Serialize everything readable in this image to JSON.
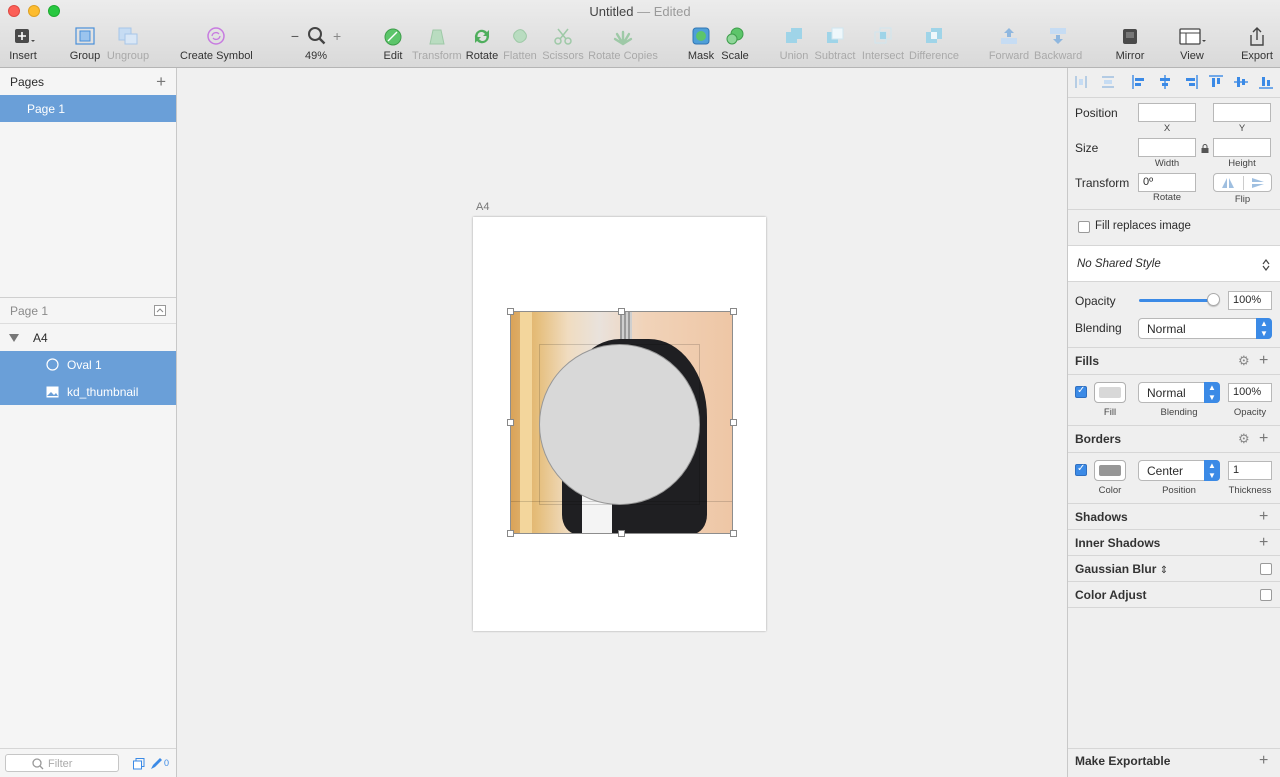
{
  "window": {
    "title": "Untitled",
    "status": "— Edited"
  },
  "toolbar": {
    "insert": "Insert",
    "group": "Group",
    "ungroup": "Ungroup",
    "create_symbol": "Create Symbol",
    "zoom": "49%",
    "edit": "Edit",
    "transform": "Transform",
    "rotate": "Rotate",
    "flatten": "Flatten",
    "scissors": "Scissors",
    "rotate_copies": "Rotate Copies",
    "mask": "Mask",
    "scale": "Scale",
    "union": "Union",
    "subtract": "Subtract",
    "intersect": "Intersect",
    "difference": "Difference",
    "forward": "Forward",
    "backward": "Backward",
    "mirror": "Mirror",
    "view": "View",
    "export": "Export"
  },
  "pages": {
    "header": "Pages",
    "items": [
      "Page 1"
    ]
  },
  "layers": {
    "page": "Page 1",
    "artboard": "A4",
    "items": [
      {
        "name": "Oval 1",
        "icon": "oval-icon"
      },
      {
        "name": "kd_thumbnail",
        "icon": "image-icon"
      }
    ]
  },
  "filter": {
    "placeholder": "Filter",
    "count": "0"
  },
  "canvas": {
    "artboard_label": "A4"
  },
  "inspector": {
    "position_label": "Position",
    "x_caption": "X",
    "y_caption": "Y",
    "size_label": "Size",
    "width_caption": "Width",
    "height_caption": "Height",
    "transform_label": "Transform",
    "rotate_value": "0º",
    "rotate_caption": "Rotate",
    "flip_caption": "Flip",
    "fill_replaces": "Fill replaces image",
    "shared_style": "No Shared Style",
    "opacity_label": "Opacity",
    "opacity_value": "100%",
    "blending_label": "Blending",
    "blending_value": "Normal",
    "fills_title": "Fills",
    "fill_caption": "Fill",
    "fill_blending": "Normal",
    "fill_blending_caption": "Blending",
    "fill_opacity": "100%",
    "fill_opacity_caption": "Opacity",
    "borders_title": "Borders",
    "border_color_caption": "Color",
    "border_position": "Center",
    "border_position_caption": "Position",
    "border_thickness": "1",
    "border_thickness_caption": "Thickness",
    "shadows_title": "Shadows",
    "inner_shadows_title": "Inner Shadows",
    "gaussian_blur_title": "Gaussian Blur",
    "color_adjust_title": "Color Adjust",
    "make_exportable": "Make Exportable"
  },
  "colors": {
    "selection": "#6a9fd8",
    "accent": "#3b8ae6",
    "fill": "#d8d8d8",
    "border": "#979797"
  }
}
